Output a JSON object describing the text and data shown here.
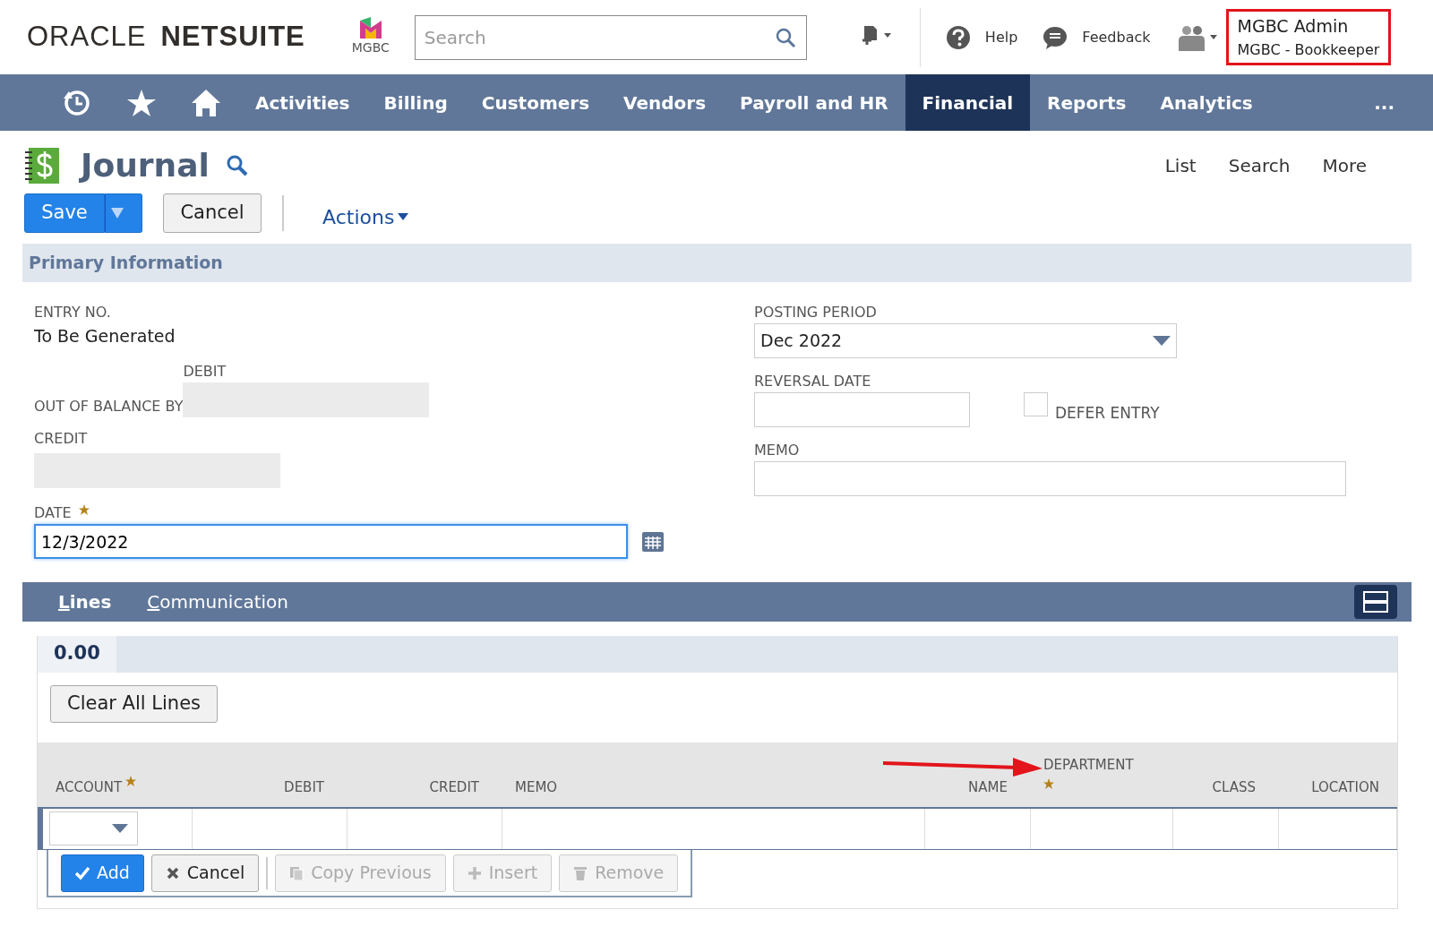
{
  "header": {
    "brand_left": "ORACLE",
    "brand_right": "NETSUITE",
    "company_logo": "MGBC",
    "search": {
      "placeholder": "Search"
    },
    "links": [
      "Help",
      "Feedback"
    ],
    "user": {
      "name": "MGBC Admin",
      "role": "MGBC - Bookkeeper"
    }
  },
  "nav": {
    "items": [
      {
        "label": "Activities",
        "selected": false
      },
      {
        "label": "Billing",
        "selected": false
      },
      {
        "label": "Customers",
        "selected": false
      },
      {
        "label": "Vendors",
        "selected": false
      },
      {
        "label": "Payroll and HR",
        "selected": false
      },
      {
        "label": "Financial",
        "selected": true
      },
      {
        "label": "Reports",
        "selected": false
      },
      {
        "label": "Analytics",
        "selected": false
      }
    ],
    "more": "..."
  },
  "page": {
    "title": "Journal",
    "links": [
      "List",
      "Search",
      "More"
    ]
  },
  "toolbar": {
    "save": "Save",
    "cancel": "Cancel",
    "actions": "Actions"
  },
  "section_title": "Primary Information",
  "fields": {
    "entry_no": {
      "label": "ENTRY NO.",
      "value": "To Be Generated"
    },
    "out_of_balance": {
      "label": "OUT OF BALANCE BY",
      "debit_label": "DEBIT",
      "credit_label": "CREDIT"
    },
    "date": {
      "label": "DATE",
      "value": "12/3/2022",
      "required": true
    },
    "posting_period": {
      "label": "POSTING PERIOD",
      "value": "Dec 2022"
    },
    "reversal_date": {
      "label": "REVERSAL DATE"
    },
    "defer_entry": {
      "label": "DEFER ENTRY",
      "checked": false
    },
    "memo": {
      "label": "MEMO"
    }
  },
  "tabs": [
    {
      "label": "Lines",
      "selected": true
    },
    {
      "label": "Communication",
      "selected": false
    }
  ],
  "subtabs": [
    {
      "label": "0.00",
      "selected": true
    }
  ],
  "clear_button": "Clear All Lines",
  "columns": [
    {
      "label": "ACCOUNT",
      "required": true
    },
    {
      "label": "DEBIT",
      "required": false
    },
    {
      "label": "CREDIT",
      "required": false
    },
    {
      "label": "MEMO",
      "required": false
    },
    {
      "label": "NAME",
      "required": false
    },
    {
      "label": "DEPARTMENT",
      "required": true
    },
    {
      "label": "CLASS",
      "required": false
    },
    {
      "label": "LOCATION",
      "required": false
    }
  ],
  "line_buttons": [
    {
      "label": "Add",
      "kind": "add",
      "disabled": false
    },
    {
      "label": "Cancel",
      "kind": "cancel",
      "disabled": false
    },
    {
      "label": "Copy Previous",
      "kind": "copy",
      "disabled": true
    },
    {
      "label": "Insert",
      "kind": "insert",
      "disabled": true
    },
    {
      "label": "Remove",
      "kind": "remove",
      "disabled": true
    }
  ]
}
